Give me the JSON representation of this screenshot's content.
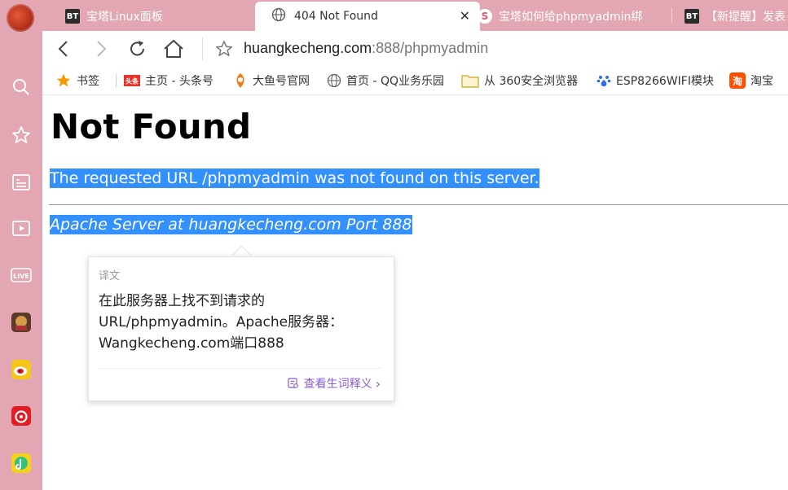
{
  "browser": {
    "tabs": [
      {
        "label": "宝塔Linux面板",
        "icon": "bt-icon",
        "active": false
      },
      {
        "label": "404 Not Found",
        "icon": "globe-icon",
        "active": true
      },
      {
        "label": "宝塔如何给phpmyadmin绑",
        "icon": "sogou-icon",
        "active": false
      },
      {
        "label": "【新提醒】发表",
        "icon": "bt-icon",
        "active": false
      }
    ],
    "bt_badge": "BT",
    "sogou_badge": "S",
    "close_glyph": "✕",
    "address": {
      "host": "huangkecheng.com",
      "path": ":888/phpmyadmin"
    },
    "bookmarks": [
      {
        "label": "书签",
        "icon": "star-icon"
      },
      {
        "label": "主页 - 头条号",
        "icon": "toutiao-icon"
      },
      {
        "label": "大鱼号官网",
        "icon": "dayu-icon"
      },
      {
        "label": "首页 - QQ业务乐园",
        "icon": "globe-icon"
      },
      {
        "label": "从 360安全浏览器",
        "icon": "folder-icon"
      },
      {
        "label": "ESP8266WIFI模块",
        "icon": "baidu-icon"
      },
      {
        "label": "淘宝",
        "icon": "taobao-icon"
      }
    ],
    "toutiao_badge": "头条",
    "taobao_badge": "淘",
    "live_badge": "LIVE"
  },
  "page": {
    "heading": "Not Found",
    "message": "The requested URL /phpmyadmin was not found on this server.",
    "address": "Apache Server at huangkecheng.com Port 888"
  },
  "translate_popup": {
    "title": "译文",
    "text": "在此服务器上找不到请求的URL/phpmyadmin。Apache服务器：Wangkecheng.com端口888",
    "more_link": "查看生词释义",
    "more_chevron": "›"
  },
  "colors": {
    "chrome": "#e2a7b3",
    "selection": "#3390ff",
    "popup_link": "#8a5cd6"
  }
}
